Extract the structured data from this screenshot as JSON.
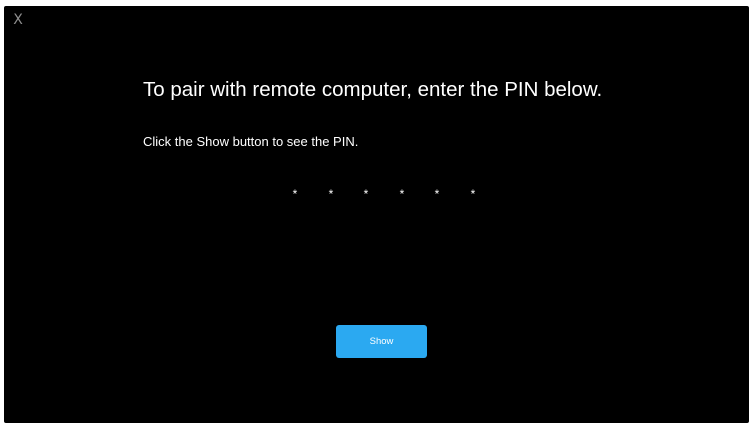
{
  "window": {
    "close_label": "X"
  },
  "pairing": {
    "heading": "To pair with remote computer, enter the PIN below.",
    "instruction": "Click the Show button to see the PIN.",
    "pin_mask": [
      "*",
      "*",
      "*",
      "*",
      "*",
      "*"
    ],
    "show_button_label": "Show"
  },
  "colors": {
    "background": "#000000",
    "text": "#ffffff",
    "close_glyph": "#8e8e8e",
    "button_accent": "#2ba9f1"
  }
}
